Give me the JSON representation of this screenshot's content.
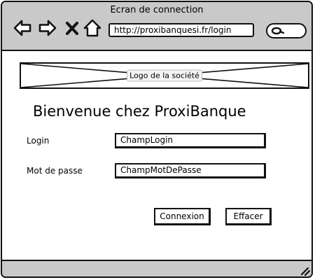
{
  "window": {
    "title": "Ecran de connection"
  },
  "browser": {
    "url": "http://proxibanquesi.fr/login",
    "icons": [
      "back-arrow-icon",
      "forward-arrow-icon",
      "close-icon",
      "home-icon",
      "search-icon"
    ]
  },
  "logo": {
    "label": "Logo de la société"
  },
  "main": {
    "title": "Bienvenue chez ProxiBanque",
    "login": {
      "label": "Login",
      "value": "ChampLogin"
    },
    "password": {
      "label": "Mot de passe",
      "value": "ChampMotDePasse"
    },
    "buttons": {
      "connect": "Connexion",
      "clear": "Effacer"
    }
  },
  "colors": {
    "chrome": "#c9c9c9",
    "stroke": "#111111",
    "background": "#ffffff"
  }
}
